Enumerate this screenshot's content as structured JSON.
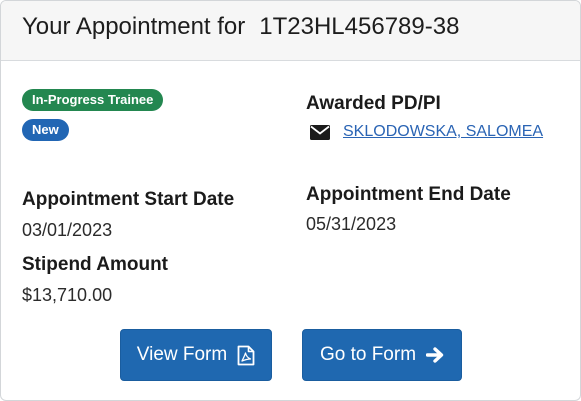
{
  "header": {
    "title": "Your Appointment for",
    "grant_number": "1T23HL456789-38"
  },
  "badges": {
    "status": "In-Progress Trainee",
    "new": "New"
  },
  "awarded_pi": {
    "label": "Awarded PD/PI",
    "name": "SKLODOWSKA, SALOMEA",
    "icon": "envelope-icon"
  },
  "appointment": {
    "start_label": "Appointment Start Date",
    "start_value": "03/01/2023",
    "end_label": "Appointment End Date",
    "end_value": "05/31/2023",
    "stipend_label": "Stipend Amount",
    "stipend_value": "$13,710.00"
  },
  "actions": {
    "view_form": "View Form",
    "view_form_icon": "pdf-file-icon",
    "go_to_form": "Go to Form",
    "go_to_form_icon": "arrow-right-icon"
  },
  "colors": {
    "badge_green": "#238750",
    "badge_blue": "#2166b4",
    "button_blue": "#1f68b0",
    "link_blue": "#2a64b4"
  }
}
